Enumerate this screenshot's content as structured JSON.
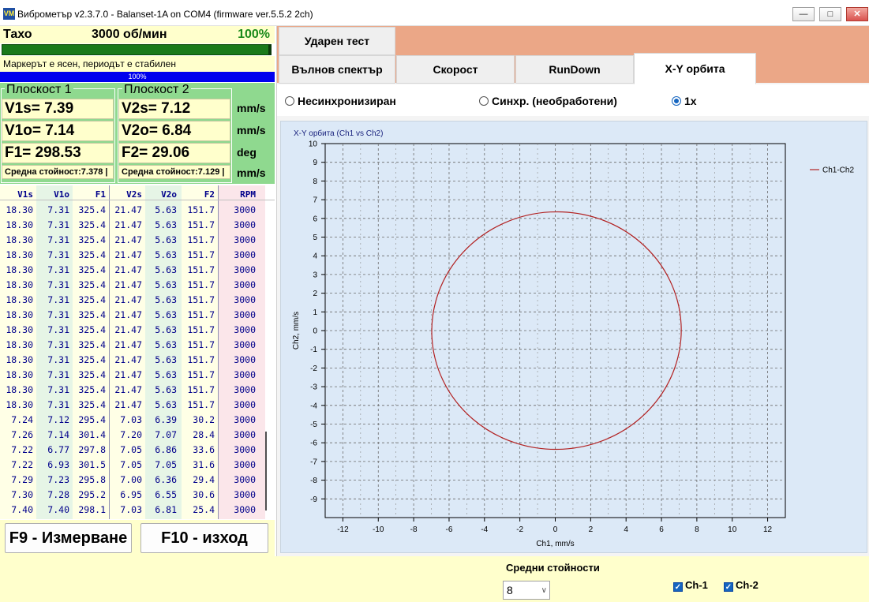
{
  "window": {
    "title": "Виброметър v2.3.7.0 - Balanset-1A on COM4 (firmware ver.5.5.2 2ch)",
    "icon_text": "VM",
    "controls": [
      "minimize-icon",
      "maximize-icon",
      "close-icon"
    ]
  },
  "tacho": {
    "label": "Тахо",
    "rpm": "3000 об/мин",
    "percent": "100%",
    "fill_fraction": 1.0,
    "status": "Маркерът е ясен, периодът е стабилен",
    "progress_text": "100%",
    "progress_fraction": 1.0
  },
  "plane1": {
    "title": "Плоскост 1",
    "v1s": "V1s= 7.39",
    "v1o": "V1o= 7.14",
    "f1": "F1= 298.53",
    "avg": "Средна стойност:7.378 |"
  },
  "plane2": {
    "title": "Плоскост 2",
    "v2s": "V2s= 7.12",
    "v2o": "V2o= 6.84",
    "f2": "F2= 29.06",
    "avg": "Средна стойност:7.129 |"
  },
  "units": [
    "mm/s",
    "mm/s",
    "deg",
    "mm/s"
  ],
  "table": {
    "headers": [
      "V1s",
      "V1o",
      "F1",
      "V2s",
      "V2o",
      "F2",
      "RPM"
    ],
    "rows": [
      [
        "18.30",
        "7.31",
        "325.4",
        "21.47",
        "5.63",
        "151.7",
        "3000"
      ],
      [
        "18.30",
        "7.31",
        "325.4",
        "21.47",
        "5.63",
        "151.7",
        "3000"
      ],
      [
        "18.30",
        "7.31",
        "325.4",
        "21.47",
        "5.63",
        "151.7",
        "3000"
      ],
      [
        "18.30",
        "7.31",
        "325.4",
        "21.47",
        "5.63",
        "151.7",
        "3000"
      ],
      [
        "18.30",
        "7.31",
        "325.4",
        "21.47",
        "5.63",
        "151.7",
        "3000"
      ],
      [
        "18.30",
        "7.31",
        "325.4",
        "21.47",
        "5.63",
        "151.7",
        "3000"
      ],
      [
        "18.30",
        "7.31",
        "325.4",
        "21.47",
        "5.63",
        "151.7",
        "3000"
      ],
      [
        "18.30",
        "7.31",
        "325.4",
        "21.47",
        "5.63",
        "151.7",
        "3000"
      ],
      [
        "18.30",
        "7.31",
        "325.4",
        "21.47",
        "5.63",
        "151.7",
        "3000"
      ],
      [
        "18.30",
        "7.31",
        "325.4",
        "21.47",
        "5.63",
        "151.7",
        "3000"
      ],
      [
        "18.30",
        "7.31",
        "325.4",
        "21.47",
        "5.63",
        "151.7",
        "3000"
      ],
      [
        "18.30",
        "7.31",
        "325.4",
        "21.47",
        "5.63",
        "151.7",
        "3000"
      ],
      [
        "18.30",
        "7.31",
        "325.4",
        "21.47",
        "5.63",
        "151.7",
        "3000"
      ],
      [
        "18.30",
        "7.31",
        "325.4",
        "21.47",
        "5.63",
        "151.7",
        "3000"
      ],
      [
        "7.24",
        "7.12",
        "295.4",
        "7.03",
        "6.39",
        "30.2",
        "3000"
      ],
      [
        "7.26",
        "7.14",
        "301.4",
        "7.20",
        "7.07",
        "28.4",
        "3000"
      ],
      [
        "7.22",
        "6.77",
        "297.8",
        "7.05",
        "6.86",
        "33.6",
        "3000"
      ],
      [
        "7.22",
        "6.93",
        "301.5",
        "7.05",
        "7.05",
        "31.6",
        "3000"
      ],
      [
        "7.29",
        "7.23",
        "295.8",
        "7.00",
        "6.36",
        "29.4",
        "3000"
      ],
      [
        "7.30",
        "7.28",
        "295.2",
        "6.95",
        "6.55",
        "30.6",
        "3000"
      ],
      [
        "7.40",
        "7.40",
        "298.1",
        "7.03",
        "6.81",
        "25.4",
        "3000"
      ]
    ]
  },
  "buttons": {
    "measure": "F9 - Измерване",
    "exit": "F10 - изход"
  },
  "tabs": {
    "row1": [
      "Ударен тест"
    ],
    "row2": [
      "Вълнов спектър",
      "Скорост",
      "RunDown",
      "X-Y орбита"
    ],
    "active": "X-Y орбита"
  },
  "radios": {
    "items": [
      "Несинхронизиран",
      "Синхр. (необработени)",
      "1x"
    ],
    "selected": "1x"
  },
  "chart_data": {
    "type": "line",
    "title": "X-Y орбита (Ch1 vs Ch2)",
    "xlabel": "Ch1, mm/s",
    "ylabel": "Ch2, mm/s",
    "xlim": [
      -13,
      13
    ],
    "ylim": [
      -10,
      10
    ],
    "xticks": [
      -12,
      -10,
      -8,
      -6,
      -4,
      -2,
      0,
      2,
      4,
      6,
      8,
      10,
      12
    ],
    "yticks": [
      10,
      9,
      8,
      7,
      6,
      5,
      4,
      3,
      2,
      1,
      0,
      -1,
      -2,
      -3,
      -4,
      -5,
      -6,
      -7,
      -8,
      -9
    ],
    "grid": true,
    "legend_position": "top-right",
    "series": [
      {
        "name": "Ch1-Ch2",
        "color": "#b22222",
        "shape": "ellipse",
        "center": [
          0.07,
          0.0
        ],
        "radius_x": 7.05,
        "radius_y": 6.35,
        "tilt_deg": -3
      }
    ]
  },
  "bottom": {
    "averages_label": "Средни стойности",
    "averages_value": "8",
    "ch1": "Ch-1",
    "ch2": "Ch-2",
    "ch1_checked": true,
    "ch2_checked": true
  },
  "colors": {
    "tab_strip": "#eba787",
    "plane_bg": "#8fd98f",
    "value_cells": "#ffffcc",
    "progress_blue": "#0000ee",
    "tacho_green": "#1a7a1a",
    "chart_bg": "#dce9f7"
  }
}
